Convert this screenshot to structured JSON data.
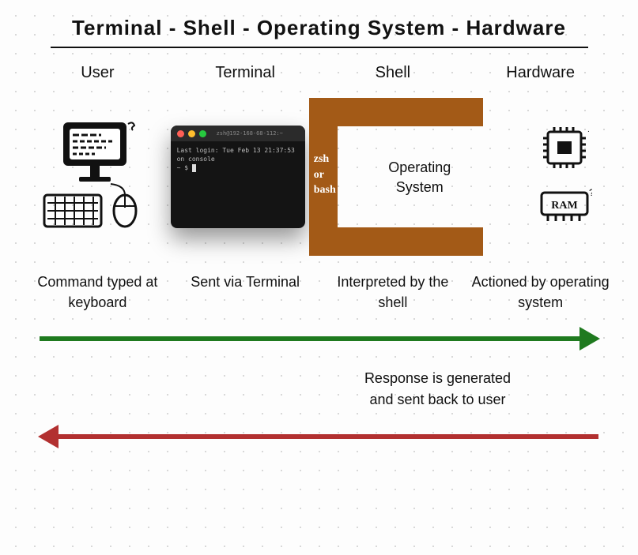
{
  "title": "Terminal - Shell - Operating System - Hardware",
  "columns": {
    "user": "User",
    "terminal": "Terminal",
    "shell": "Shell",
    "hardware": "Hardware"
  },
  "terminal_window": {
    "title": "zsh@192-168-68-112:~",
    "line1": "Last login: Tue Feb 13 21:37:53 on console",
    "prompt": "~ $"
  },
  "shell": {
    "labels": [
      "zsh",
      "or",
      "bash"
    ],
    "os_label_line1": "Operating",
    "os_label_line2": "System"
  },
  "hardware": {
    "ram_label": "RAM"
  },
  "descriptions": {
    "user": "Command typed at keyboard",
    "terminal": "Sent via Terminal",
    "shell": "Interpreted by the shell",
    "hardware": "Actioned by operating system"
  },
  "response_line1": "Response is generated",
  "response_line2": "and sent back to user",
  "colors": {
    "shell_brown": "#a35a17",
    "arrow_green": "#1f7a1f",
    "arrow_red": "#b23030"
  }
}
